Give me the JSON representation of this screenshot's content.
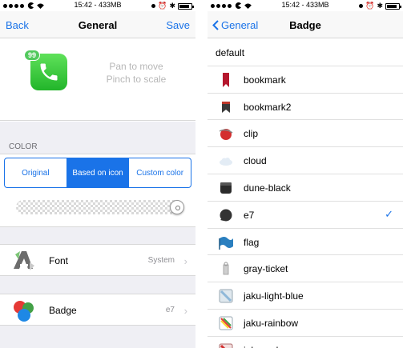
{
  "left": {
    "status": {
      "time": "15:42 - 433MB"
    },
    "nav": {
      "back": "Back",
      "title": "General",
      "action": "Save"
    },
    "preview": {
      "badge_count": "99",
      "hint_line1": "Pan to move",
      "hint_line2": "Pinch to scale"
    },
    "color_section": {
      "label": "COLOR",
      "segments": [
        "Original",
        "Based on icon",
        "Custom color"
      ],
      "selected_index": 1,
      "opacity_value": 1.0
    },
    "rows": [
      {
        "label": "Font",
        "value": "System",
        "icon": "font-icon"
      },
      {
        "label": "Badge",
        "value": "e7",
        "icon": "badge-icon"
      }
    ]
  },
  "right": {
    "status": {
      "time": "15:42 - 433MB"
    },
    "nav": {
      "back": "General",
      "title": "Badge"
    },
    "items": [
      {
        "label": "default",
        "icon": ""
      },
      {
        "label": "bookmark",
        "icon": "bookmark-icon"
      },
      {
        "label": "bookmark2",
        "icon": "bookmark2-icon"
      },
      {
        "label": "clip",
        "icon": "clip-icon"
      },
      {
        "label": "cloud",
        "icon": "cloud-icon"
      },
      {
        "label": "dune-black",
        "icon": "dune-black-icon"
      },
      {
        "label": "e7",
        "icon": "e7-icon",
        "selected": true
      },
      {
        "label": "flag",
        "icon": "flag-icon"
      },
      {
        "label": "gray-ticket",
        "icon": "gray-ticket-icon"
      },
      {
        "label": "jaku-light-blue",
        "icon": "jaku-light-blue-icon"
      },
      {
        "label": "jaku-rainbow",
        "icon": "jaku-rainbow-icon"
      },
      {
        "label": "jaku-red",
        "icon": "jaku-red-icon"
      }
    ],
    "check_glyph": "✓"
  },
  "colors": {
    "accent": "#1a73e8",
    "group_bg": "#efeff4"
  }
}
